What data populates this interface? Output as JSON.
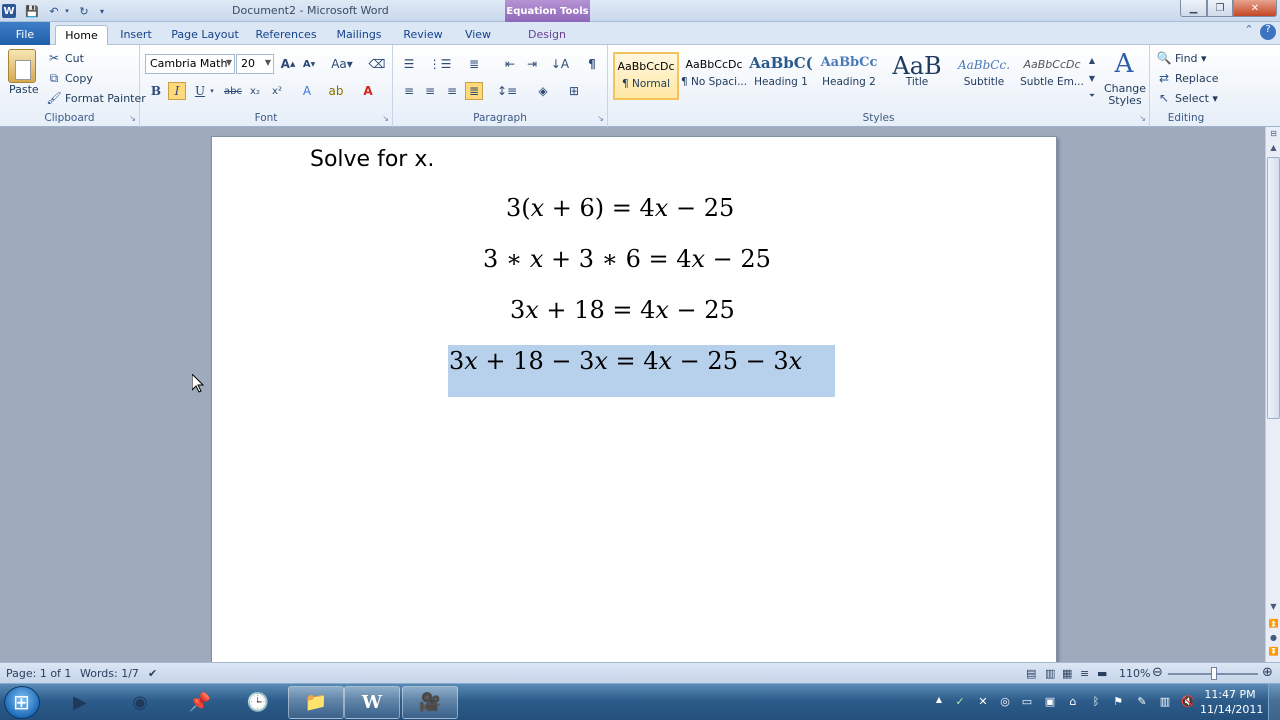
{
  "app": {
    "title": "Document2 - Microsoft Word",
    "contextual_tab_group": "Equation Tools"
  },
  "tabs": [
    "File",
    "Home",
    "Insert",
    "Page Layout",
    "References",
    "Mailings",
    "Review",
    "View",
    "Design"
  ],
  "clipboard": {
    "paste": "Paste",
    "cut": "Cut",
    "copy": "Copy",
    "format_painter": "Format Painter",
    "label": "Clipboard"
  },
  "font": {
    "name": "Cambria Math",
    "size": "20",
    "label": "Font"
  },
  "paragraph": {
    "label": "Paragraph"
  },
  "styles": {
    "items": [
      {
        "preview": "AaBbCcDc",
        "name": "¶ Normal"
      },
      {
        "preview": "AaBbCcDc",
        "name": "¶ No Spaci..."
      },
      {
        "preview": "AaBbC(",
        "name": "Heading 1"
      },
      {
        "preview": "AaBbCc",
        "name": "Heading 2"
      },
      {
        "preview": "AaB",
        "name": "Title"
      },
      {
        "preview": "AaBbCc.",
        "name": "Subtitle"
      },
      {
        "preview": "AaBbCcDc",
        "name": "Subtle Em..."
      }
    ],
    "change_styles": "Change Styles",
    "label": "Styles"
  },
  "editing": {
    "find": "Find",
    "replace": "Replace",
    "select": "Select",
    "label": "Editing"
  },
  "document": {
    "heading": "Solve for x.",
    "equations": [
      "3(𝑥 + 6) = 4𝑥 − 25",
      "3 ∗ 𝑥 + 3 ∗ 6 = 4𝑥 − 25",
      "3𝑥 + 18 = 4𝑥 − 25",
      "3𝑥 + 18 − 3𝑥 = 4𝑥 − 25 − 3𝑥"
    ]
  },
  "status": {
    "page": "Page: 1 of 1",
    "words": "Words: 1/7",
    "zoom": "110%"
  },
  "taskbar": {
    "time": "11:47 PM",
    "date": "11/14/2011"
  },
  "colors": {
    "selection": "#b7d1ec",
    "contextual_tab": "#8c63b6",
    "file_tab": "#1f5ea9"
  }
}
